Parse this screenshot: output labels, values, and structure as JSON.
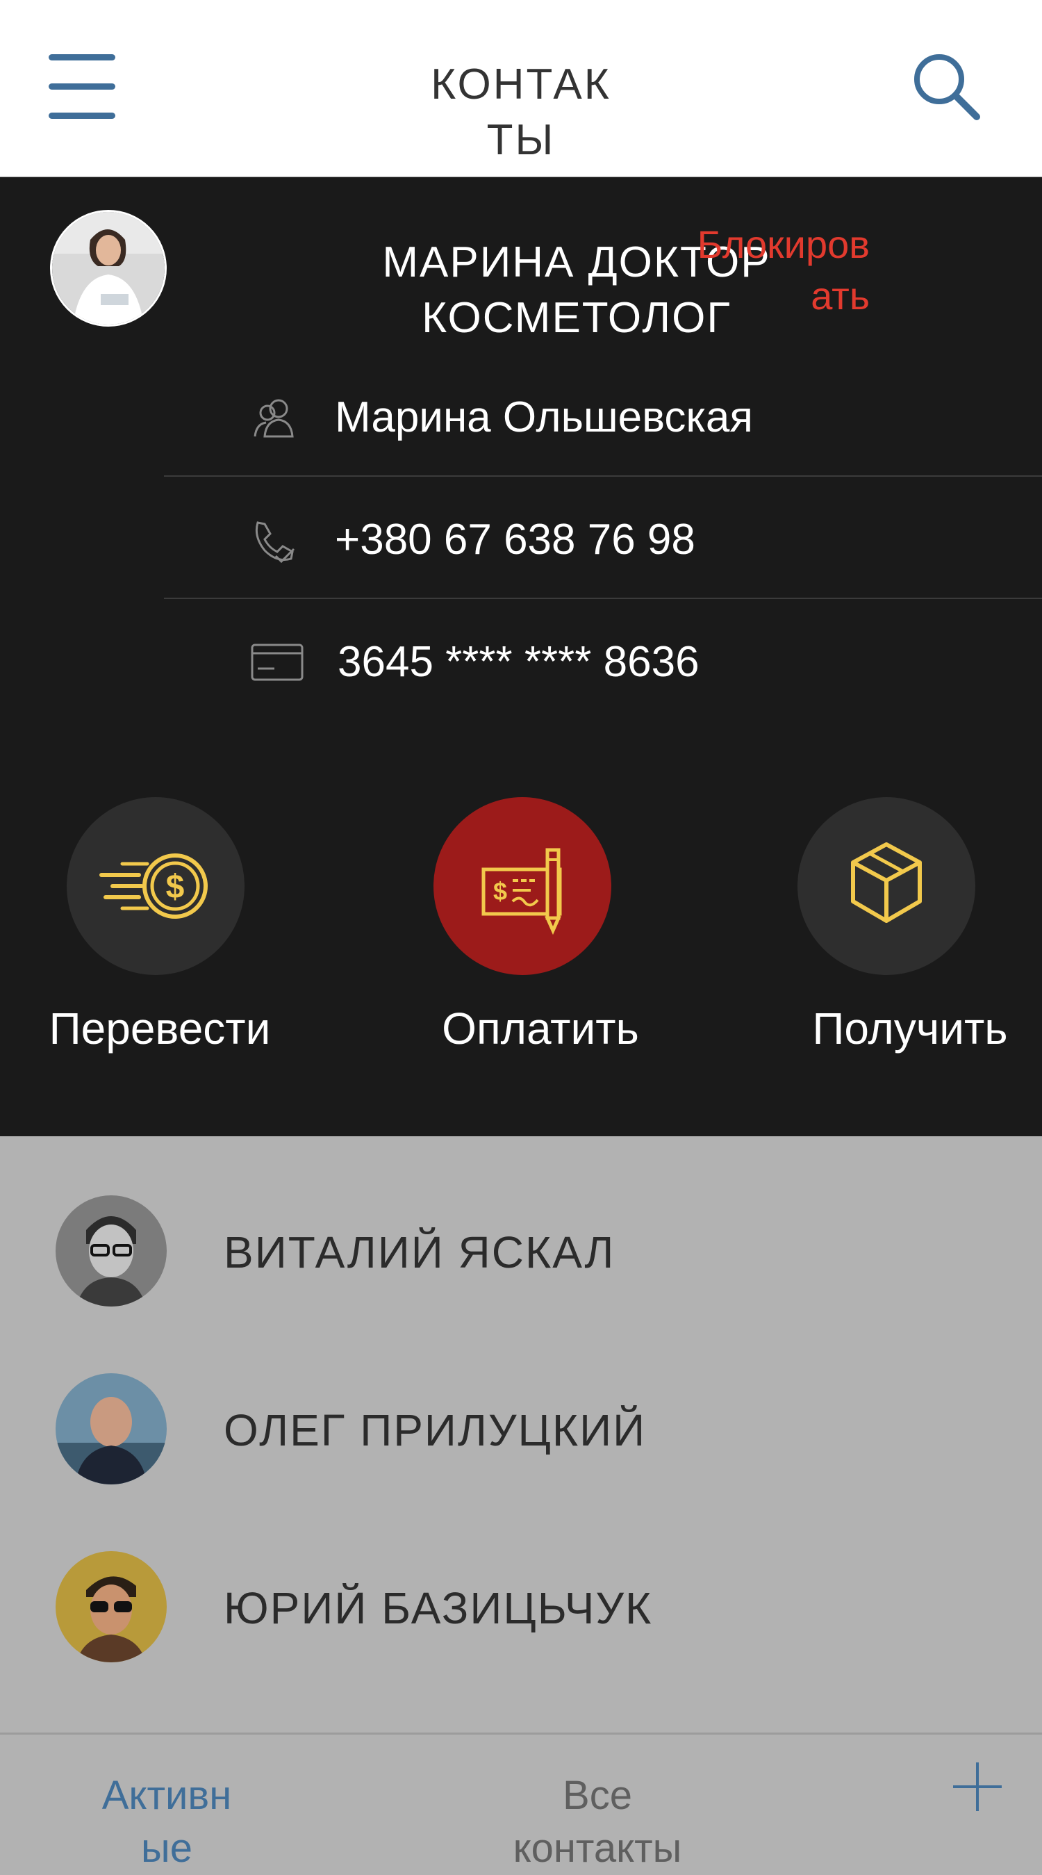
{
  "header": {
    "title_line1": "КОНТАК",
    "title_line2": "ТЫ",
    "menu_icon": "hamburger-menu-icon",
    "search_icon": "search-icon"
  },
  "profile": {
    "name_line1": "МАРИНА ДОКТОР",
    "name_line2": "КОСМЕТОЛОГ",
    "contact_name": "Марина Ольшевская",
    "block_line1": "Блокиров",
    "block_line2": "ать",
    "phone": "+380 67 638 76 98",
    "card": "3645 **** **** 8636"
  },
  "actions": [
    {
      "label": "Перевести",
      "icon": "coin-transfer-icon",
      "color": "#2e2e2e"
    },
    {
      "label": "Оплатить",
      "icon": "cheque-pen-icon",
      "color": "#9c1b1a"
    },
    {
      "label": "Получить",
      "icon": "box-icon",
      "color": "#2e2e2e"
    }
  ],
  "contacts": [
    {
      "name": "ВИТАЛИЙ ЯСКАЛ"
    },
    {
      "name": "ОЛЕГ ПРИЛУЦКИЙ"
    },
    {
      "name": "ЮРИЙ БАЗИЦЬЧУК"
    }
  ],
  "tabs": {
    "active_line1": "Активн",
    "active_line2": "ые",
    "all_line1": "Все",
    "all_line2": "контакты",
    "add_icon": "plus-icon"
  },
  "colors": {
    "accent_blue": "#3f6e99",
    "danger_red": "#e23a2e",
    "icon_yellow": "#f2c94c",
    "dark_panel": "#1a1a1a",
    "list_bg": "#b2b2b2"
  }
}
